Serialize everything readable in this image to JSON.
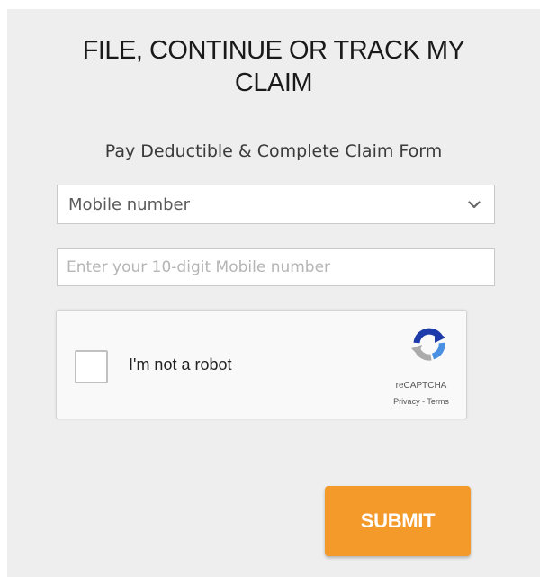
{
  "form": {
    "title_line1": "FILE, CONTINUE OR TRACK MY",
    "title_line2": "CLAIM",
    "subtitle": "Pay Deductible & Complete Claim Form",
    "lookup_select": {
      "selected": "Mobile number"
    },
    "mobile_input": {
      "value": "",
      "placeholder": "Enter your 10-digit Mobile number"
    },
    "recaptcha": {
      "label": "I'm not a robot",
      "checked": false,
      "brand": "reCAPTCHA",
      "privacy": "Privacy",
      "separator": " - ",
      "terms": "Terms"
    },
    "submit_label": "SUBMIT"
  },
  "colors": {
    "panel_bg": "#eeeeee",
    "accent": "#f39a2b",
    "recaptcha_blue_dark": "#1c3aa9",
    "recaptcha_blue": "#4a90e2",
    "recaptcha_gray": "#ababab"
  },
  "icons": {
    "dropdown": "chevron-down-icon",
    "recaptcha": "recaptcha-logo-icon"
  }
}
